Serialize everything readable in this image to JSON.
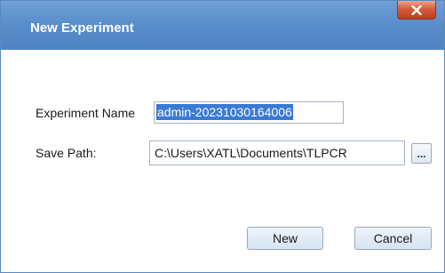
{
  "window": {
    "title": "New Experiment",
    "close_icon": "close-x-icon"
  },
  "form": {
    "name_label": "Experiment Name",
    "name_value": "admin-20231030164006",
    "name_selected": true,
    "path_label": "Save Path:",
    "path_value": "C:\\Users\\XATL\\Documents\\TLPCR",
    "browse_label": "..."
  },
  "buttons": {
    "new_label": "New",
    "cancel_label": "Cancel"
  },
  "colors": {
    "titlebar": "#5b8fcb",
    "selection": "#3a7ad6",
    "close": "#d55c40"
  }
}
